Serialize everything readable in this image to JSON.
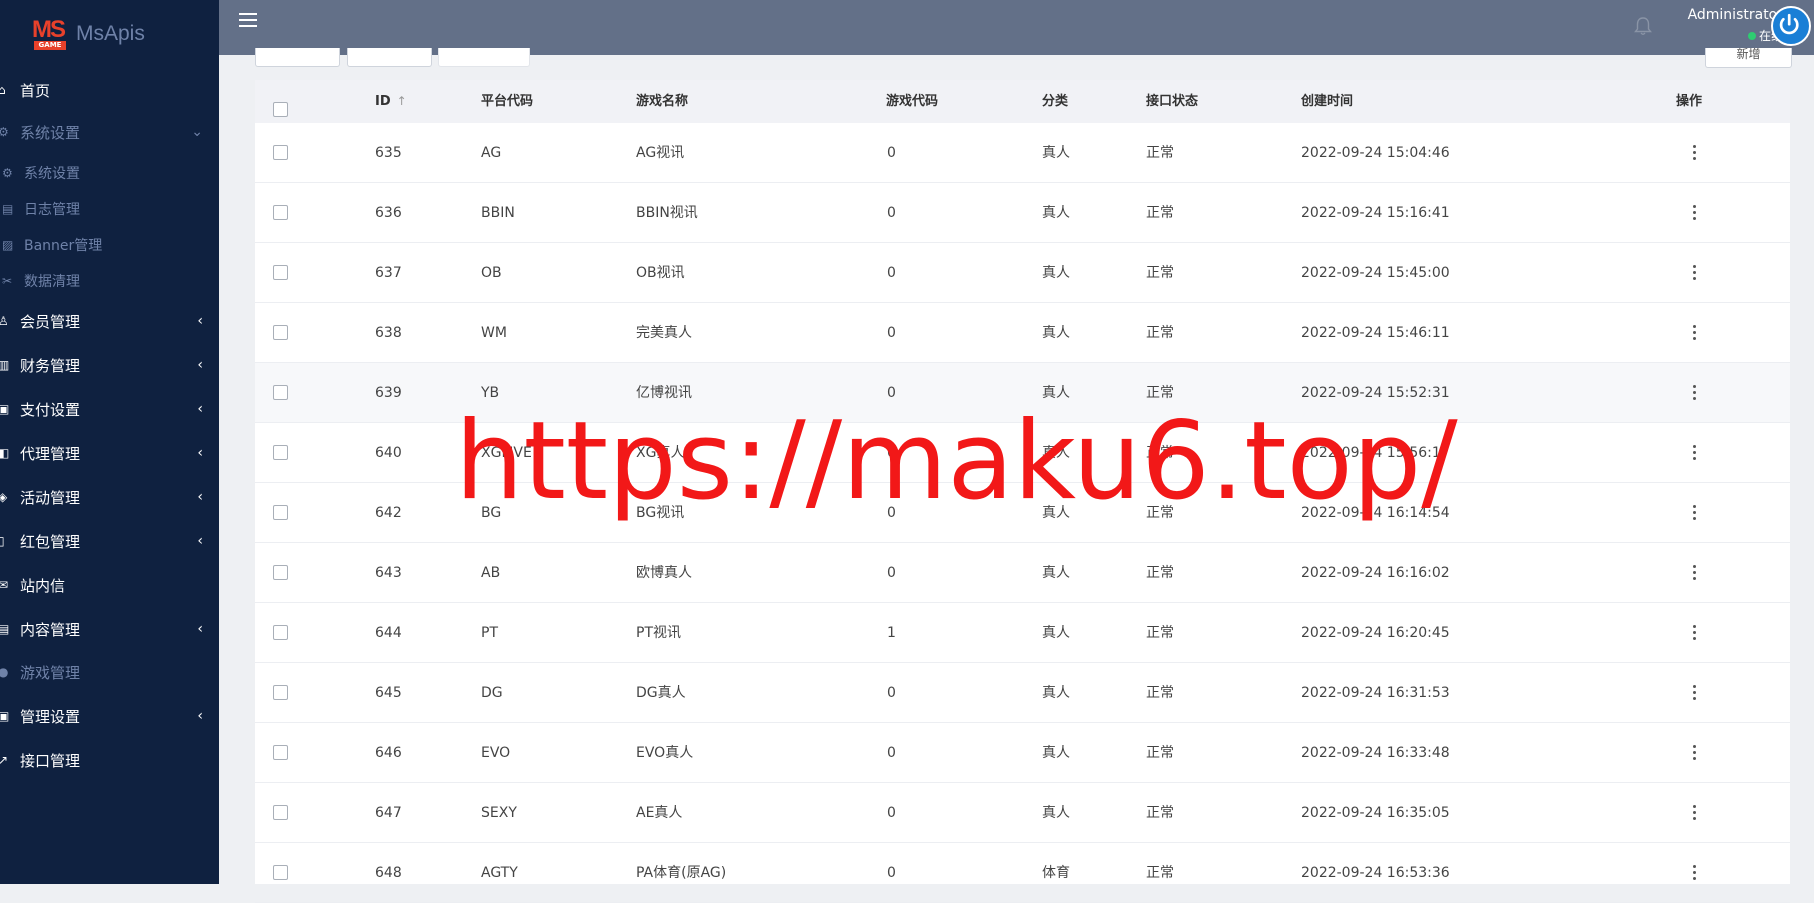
{
  "brand": {
    "logo_text": "MS",
    "logo_subtext": "GAME",
    "name": "MsApis"
  },
  "nav": [
    {
      "icon": "home-icon",
      "label": "首页",
      "has_chevron": false
    },
    {
      "icon": "settings-icon",
      "label": "系统设置",
      "has_chevron": true,
      "expanded": true
    },
    {
      "icon": "gear-icon",
      "label": "系统设置",
      "sub": true
    },
    {
      "icon": "file-icon",
      "label": "日志管理",
      "sub": true
    },
    {
      "icon": "image-icon",
      "label": "Banner管理",
      "sub": true
    },
    {
      "icon": "scissors-icon",
      "label": "数据清理",
      "sub": true
    },
    {
      "icon": "user-icon",
      "label": "会员管理",
      "has_chevron": true
    },
    {
      "icon": "finance-icon",
      "label": "财务管理",
      "has_chevron": true
    },
    {
      "icon": "payment-icon",
      "label": "支付设置",
      "has_chevron": true
    },
    {
      "icon": "agent-icon",
      "label": "代理管理",
      "has_chevron": true
    },
    {
      "icon": "activity-icon",
      "label": "活动管理",
      "has_chevron": true
    },
    {
      "icon": "redpacket-icon",
      "label": "红包管理",
      "has_chevron": true
    },
    {
      "icon": "message-icon",
      "label": "站内信",
      "has_chevron": false
    },
    {
      "icon": "content-icon",
      "label": "内容管理",
      "has_chevron": true
    },
    {
      "icon": "game-icon",
      "label": "游戏管理",
      "has_chevron": false,
      "active": true
    },
    {
      "icon": "admin-icon",
      "label": "管理设置",
      "has_chevron": true
    },
    {
      "icon": "api-icon",
      "label": "接口管理",
      "has_chevron": false
    }
  ],
  "header": {
    "user_name": "Administrator",
    "user_status": "在线",
    "right_button_label": "新增"
  },
  "table": {
    "columns": [
      "ID",
      "平台代码",
      "游戏名称",
      "游戏代码",
      "分类",
      "接口状态",
      "创建时间",
      "操作"
    ],
    "rows": [
      {
        "id": "635",
        "platform": "AG",
        "name": "AG视讯",
        "code": "0",
        "category": "真人",
        "status": "正常",
        "created": "2022-09-24 15:04:46"
      },
      {
        "id": "636",
        "platform": "BBIN",
        "name": "BBIN视讯",
        "code": "0",
        "category": "真人",
        "status": "正常",
        "created": "2022-09-24 15:16:41"
      },
      {
        "id": "637",
        "platform": "OB",
        "name": "OB视讯",
        "code": "0",
        "category": "真人",
        "status": "正常",
        "created": "2022-09-24 15:45:00"
      },
      {
        "id": "638",
        "platform": "WM",
        "name": "完美真人",
        "code": "0",
        "category": "真人",
        "status": "正常",
        "created": "2022-09-24 15:46:11"
      },
      {
        "id": "639",
        "platform": "YB",
        "name": "亿博视讯",
        "code": "0",
        "category": "真人",
        "status": "正常",
        "created": "2022-09-24 15:52:31"
      },
      {
        "id": "640",
        "platform": "XGLIVE",
        "name": "XG真人",
        "code": "0",
        "category": "真人",
        "status": "正常",
        "created": "2022-09-24 15:56:17"
      },
      {
        "id": "642",
        "platform": "BG",
        "name": "BG视讯",
        "code": "0",
        "category": "真人",
        "status": "正常",
        "created": "2022-09-24 16:14:54"
      },
      {
        "id": "643",
        "platform": "AB",
        "name": "欧博真人",
        "code": "0",
        "category": "真人",
        "status": "正常",
        "created": "2022-09-24 16:16:02"
      },
      {
        "id": "644",
        "platform": "PT",
        "name": "PT视讯",
        "code": "1",
        "category": "真人",
        "status": "正常",
        "created": "2022-09-24 16:20:45"
      },
      {
        "id": "645",
        "platform": "DG",
        "name": "DG真人",
        "code": "0",
        "category": "真人",
        "status": "正常",
        "created": "2022-09-24 16:31:53"
      },
      {
        "id": "646",
        "platform": "EVO",
        "name": "EVO真人",
        "code": "0",
        "category": "真人",
        "status": "正常",
        "created": "2022-09-24 16:33:48"
      },
      {
        "id": "647",
        "platform": "SEXY",
        "name": "AE真人",
        "code": "0",
        "category": "真人",
        "status": "正常",
        "created": "2022-09-24 16:35:05"
      },
      {
        "id": "648",
        "platform": "AGTY",
        "name": "PA体育(原AG)",
        "code": "0",
        "category": "体育",
        "status": "正常",
        "created": "2022-09-24 16:53:36"
      }
    ]
  },
  "watermark": "https://maku6.top/",
  "colors": {
    "sidebar_bg": "#0f2140",
    "header_bg": "#637088",
    "watermark": "#f21818",
    "online_dot": "#2ecc71"
  }
}
